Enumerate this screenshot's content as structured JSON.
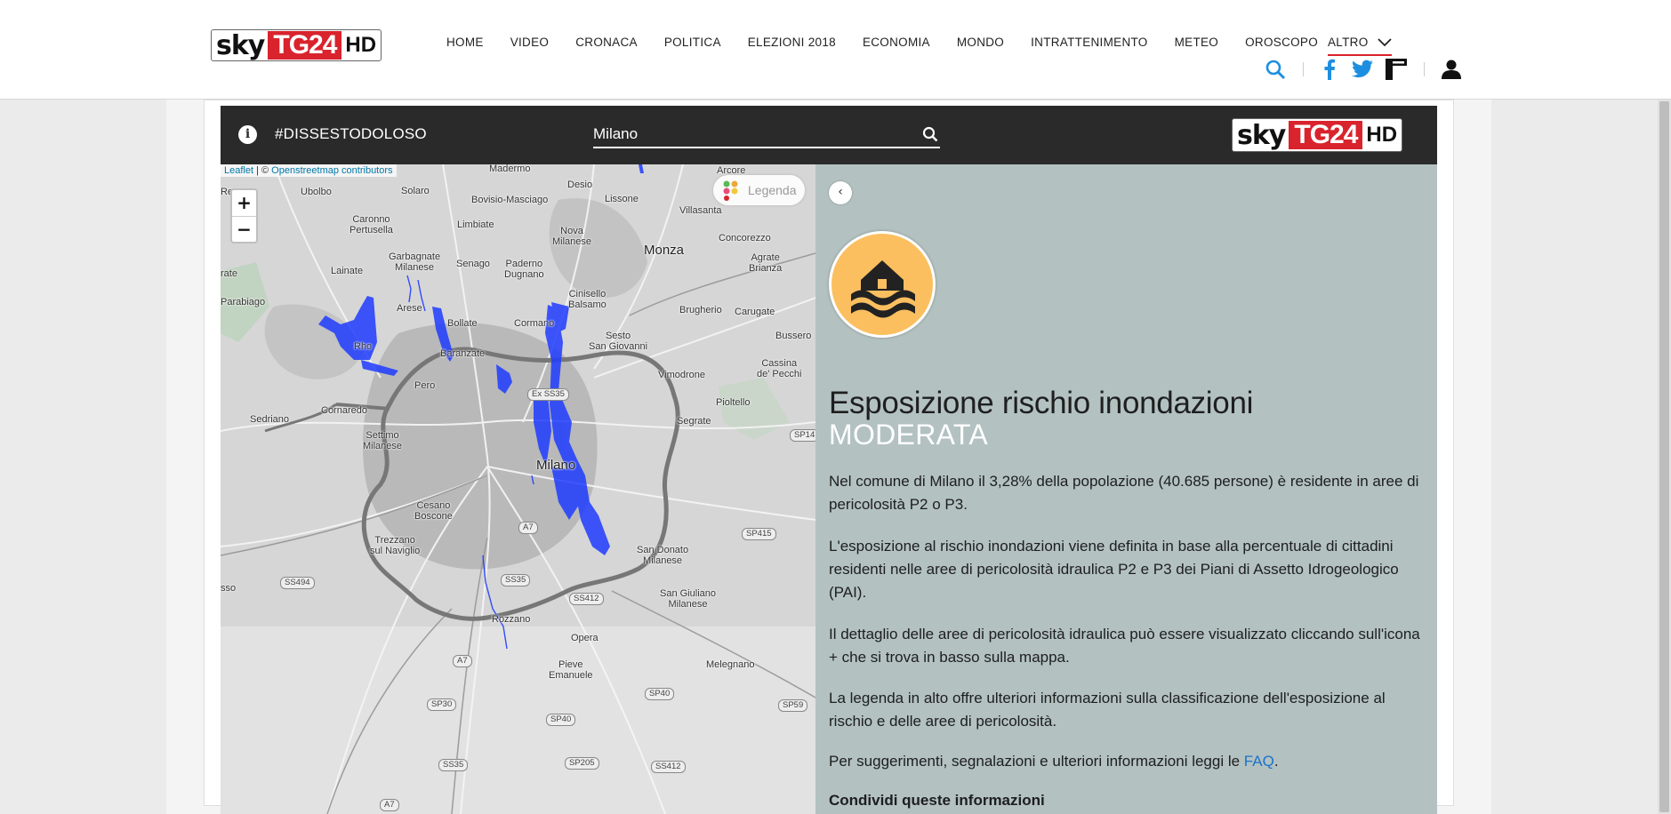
{
  "header": {
    "logo": {
      "sky": "sky",
      "tg": "TG24",
      "hd": "HD"
    },
    "nav": [
      "HOME",
      "VIDEO",
      "CRONACA",
      "POLITICA",
      "ELEZIONI 2018",
      "ECONOMIA",
      "MONDO",
      "INTRATTENIMENTO",
      "METEO",
      "OROSCOPO"
    ],
    "nav_more": "ALTRO",
    "icons": [
      "search-icon",
      "facebook-icon",
      "twitter-icon",
      "flipboard-icon",
      "user-icon"
    ]
  },
  "widget": {
    "hashtag": "#DISSESTODOLOSO",
    "search": {
      "value": "Milano",
      "placeholder": ""
    },
    "logo": {
      "sky": "sky",
      "tg": "TG24",
      "hd": "HD"
    }
  },
  "map": {
    "attribution": {
      "leaflet": "Leaflet",
      "sep": " | © ",
      "osm": "Openstreetmap contributors"
    },
    "zoom_in": "+",
    "zoom_out": "−",
    "legend_label": "Legenda",
    "places": [
      {
        "name": "Madermo",
        "big": false
      },
      {
        "name": "Desio",
        "big": false
      },
      {
        "name": "Arcore",
        "big": false
      },
      {
        "name": "Ubolbo",
        "big": false
      },
      {
        "name": "Solaro",
        "big": false
      },
      {
        "name": "Bovisio-Masciago",
        "big": false
      },
      {
        "name": "Lissone",
        "big": false
      },
      {
        "name": "Villasanta",
        "big": false
      },
      {
        "name": "Caronno\nPertusella",
        "big": false
      },
      {
        "name": "Limbiate",
        "big": false
      },
      {
        "name": "Nova\nMilanese",
        "big": false
      },
      {
        "name": "Monza",
        "big": true
      },
      {
        "name": "Concorezzo",
        "big": false
      },
      {
        "name": "Garbagnate\nMilanese",
        "big": false
      },
      {
        "name": "Senago",
        "big": false
      },
      {
        "name": "Paderno\nDugnano",
        "big": false
      },
      {
        "name": "Agrate\nBrianza",
        "big": false
      },
      {
        "name": "Lainate",
        "big": false
      },
      {
        "name": "Cinisello\nBalsamo",
        "big": false
      },
      {
        "name": "Parabiago",
        "big": false
      },
      {
        "name": "Arese",
        "big": false
      },
      {
        "name": "Brugherio",
        "big": false
      },
      {
        "name": "Carugate",
        "big": false
      },
      {
        "name": "Bollate",
        "big": false
      },
      {
        "name": "Cormano",
        "big": false
      },
      {
        "name": "Sesto\nSan Giovanni",
        "big": false
      },
      {
        "name": "Bussero",
        "big": false
      },
      {
        "name": "Rho",
        "big": false
      },
      {
        "name": "Baranzate",
        "big": false
      },
      {
        "name": "Cassina\nde' Pecchi",
        "big": false
      },
      {
        "name": "Vimodrone",
        "big": false
      },
      {
        "name": "Pero",
        "big": false
      },
      {
        "name": "Cornaredo",
        "big": false
      },
      {
        "name": "Pioltello",
        "big": false
      },
      {
        "name": "Sedriano",
        "big": false
      },
      {
        "name": "Segrate",
        "big": false
      },
      {
        "name": "Settimo\nMilanese",
        "big": false
      },
      {
        "name": "Milano",
        "big": true
      },
      {
        "name": "Cesano\nBoscone",
        "big": false
      },
      {
        "name": "Trezzano\nsul Naviglio",
        "big": false
      },
      {
        "name": "San Donato\nMilanese",
        "big": false
      },
      {
        "name": "San Giuliano\nMilanese",
        "big": false
      },
      {
        "name": "Rozzano",
        "big": false
      },
      {
        "name": "Opera",
        "big": false
      },
      {
        "name": "Pieve\nEmanuele",
        "big": false
      },
      {
        "name": "Melegnano",
        "big": false
      },
      {
        "name": "Re",
        "big": false
      },
      {
        "name": "rate",
        "big": false
      },
      {
        "name": "sso",
        "big": false
      }
    ],
    "roads": [
      "Ex SS35",
      "A7",
      "SS494",
      "SS35",
      "SS412",
      "SP415",
      "A7",
      "SP30",
      "SP40",
      "SP40",
      "SS35",
      "SP205",
      "SS412",
      "SP59",
      "A7",
      "SP14"
    ]
  },
  "panel": {
    "collapse": "‹",
    "title": "Esposizione rischio inondazioni",
    "level": "MODERATA",
    "paragraphs": [
      "Nel comune di Milano il 3,28% della popolazione (40.685 persone) è residente in aree di pericolosità P2 o P3.",
      "L'esposizione al rischio inondazioni viene definita in base alla percentuale di cittadini residenti nelle aree di pericolosità idraulica P2 e P3 dei Piani di Assetto Idrogeologico (PAI).",
      "Il dettaglio delle aree di pericolosità idraulica può essere visualizzato cliccando sull'icona + che si trova in basso sulla mappa.",
      "La legenda in alto offre ulteriori informazioni sulla classificazione dell'esposizione al rischio e delle aree di pericolosità."
    ],
    "faq_prefix": "Per suggerimenti, segnalazioni e ulteriori informazioni leggi le ",
    "faq_link": "FAQ",
    "faq_suffix": ".",
    "share_heading": "Condividi queste informazioni"
  },
  "colors": {
    "brand_red": "#d9232d",
    "flood_blue": "#1f3cff",
    "panel_bg": "#b3c1c1",
    "risk_badge": "#fbbf60",
    "widget_bar": "#2a2a2a"
  }
}
